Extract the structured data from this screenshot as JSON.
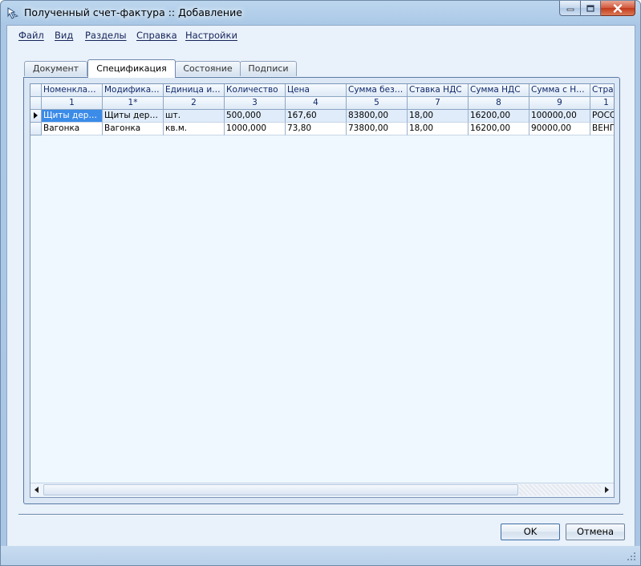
{
  "window": {
    "title": "Полученный счет-фактура :: Добавление"
  },
  "menu": [
    "Файл",
    "Вид",
    "Разделы",
    "Справка",
    "Настройки"
  ],
  "tabs": [
    "Документ",
    "Спецификация",
    "Состояние",
    "Подписи"
  ],
  "active_tab": "Спецификация",
  "grid": {
    "columns": [
      "Номенклат…",
      "Модифика…",
      "Единица из…",
      "Количество",
      "Цена",
      "Сумма без …",
      "Ставка НДС",
      "Сумма НДС",
      "Сумма с НДС",
      "Стра"
    ],
    "column_numbers": [
      "1",
      "1*",
      "2",
      "3",
      "4",
      "5",
      "7",
      "8",
      "9",
      "1"
    ],
    "rows": [
      [
        "Щиты дер…",
        "Щиты дер…",
        "шт.",
        "500,000",
        "167,60",
        "83800,00",
        "18,00",
        "16200,00",
        "100000,00",
        "РОСС"
      ],
      [
        "Вагонка",
        "Вагонка",
        "кв.м.",
        "1000,000",
        "73,80",
        "73800,00",
        "18,00",
        "16200,00",
        "90000,00",
        "ВЕНГ"
      ]
    ]
  },
  "buttons": {
    "ok": "OK",
    "cancel": "Отмена"
  },
  "colors": {
    "selection": "#3b8be8",
    "header_text": "#10286a",
    "close_button": "#c13a1c"
  }
}
